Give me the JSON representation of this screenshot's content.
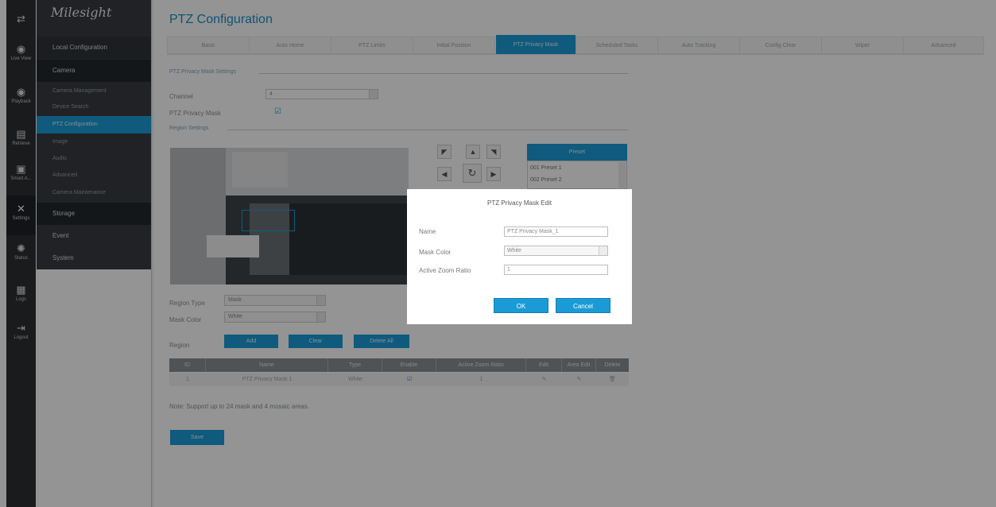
{
  "app": {
    "logo": "Milesight"
  },
  "rail": [
    {
      "icon": "swap-arrows-icon",
      "glyph": "⇄",
      "label": ""
    },
    {
      "icon": "live-view-icon",
      "glyph": "◉",
      "label": "Live View"
    },
    {
      "icon": "playback-icon",
      "glyph": "◉",
      "label": "Playback"
    },
    {
      "icon": "retrieve-icon",
      "glyph": "▤",
      "label": "Retrieve"
    },
    {
      "icon": "smart-analytics-icon",
      "glyph": "▣",
      "label": "Smart A..."
    },
    {
      "icon": "settings-icon",
      "glyph": "✕",
      "label": "Settings"
    },
    {
      "icon": "status-icon",
      "glyph": "✺",
      "label": "Status"
    },
    {
      "icon": "logs-icon",
      "glyph": "▦",
      "label": "Logs"
    },
    {
      "icon": "logout-icon",
      "glyph": "⇥",
      "label": "Logout"
    }
  ],
  "menu": {
    "local": "Local Configuration",
    "camera": "Camera",
    "camera_items": [
      "Camera Management",
      "Device Search",
      "PTZ Configuration",
      "Image",
      "Audio",
      "Advanced",
      "Camera Maintenance"
    ],
    "storage": "Storage",
    "event": "Event",
    "system": "System"
  },
  "page": {
    "title": "PTZ Configuration"
  },
  "tabs": [
    "Basic",
    "Auto Home",
    "PTZ Limits",
    "Initial Position",
    "PTZ Privacy Mask",
    "Scheduled Tasks",
    "Auto Tracking",
    "Config Clear",
    "Wiper",
    "Advanced"
  ],
  "privacy_settings": {
    "section": "PTZ Privacy Mask Settings",
    "channel_label": "Channel",
    "channel_value": "4",
    "mask_label": "PTZ Privacy Mask",
    "mask_checked": "☑"
  },
  "region_settings": {
    "section": "Region Settings",
    "region_type_label": "Region Type",
    "region_type_value": "Mask",
    "mask_color_label": "Mask Color",
    "mask_color_value": "White",
    "region_label": "Region",
    "add": "Add",
    "clear": "Clear",
    "delete_all": "Delete All"
  },
  "preset": {
    "header": "Preset",
    "items": [
      "001  Preset 1",
      "002  Preset 2"
    ]
  },
  "table": {
    "headers": [
      "ID",
      "Name",
      "Type",
      "Enable",
      "Active Zoom Ratio",
      "Edit",
      "Area Edit",
      "Delete"
    ],
    "rows": [
      [
        "1",
        "PTZ Privacy Mask 1",
        "White",
        "☑",
        "1",
        "✎",
        "✎",
        "🗑"
      ]
    ]
  },
  "note": "Note: Support up to 24 mask and 4 mosaic areas.",
  "save": "Save",
  "modal": {
    "title": "PTZ Privacy Mask Edit",
    "name_label": "Name",
    "name_value": "PTZ Privacy Mask_1",
    "color_label": "Mask Color",
    "color_value": "White",
    "zoom_label": "Active Zoom Ratio",
    "zoom_value": "1",
    "ok": "OK",
    "cancel": "Cancel"
  },
  "colors": {
    "accent": "#1a9bd7",
    "sidebar": "#383c40",
    "rail": "#2b2f33"
  }
}
